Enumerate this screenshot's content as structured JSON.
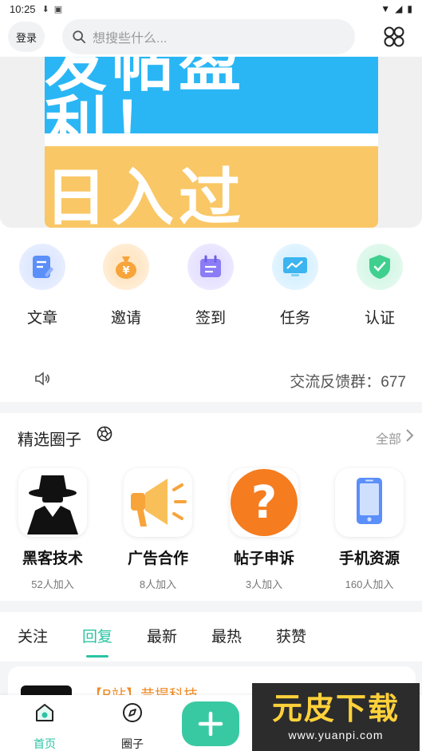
{
  "status_bar": {
    "time": "10:25"
  },
  "header": {
    "login_label": "登录",
    "search_placeholder": "想搜些什么..."
  },
  "banner": {
    "line1": "发帖盈利！",
    "line2": "日入过百！"
  },
  "shortcuts": [
    {
      "label": "文章",
      "icon": "article-icon",
      "color": "#5b8ff9"
    },
    {
      "label": "邀请",
      "icon": "money-bag-icon",
      "color": "#f7a43b"
    },
    {
      "label": "签到",
      "icon": "calendar-icon",
      "color": "#8b7cf6"
    },
    {
      "label": "任务",
      "icon": "monitor-chart-icon",
      "color": "#3bb4ef"
    },
    {
      "label": "认证",
      "icon": "shield-check-icon",
      "color": "#3fcf8e"
    }
  ],
  "notice": {
    "text": "交流反馈群：677"
  },
  "circles": {
    "title": "精选圈子",
    "all_label": "全部",
    "items": [
      {
        "name": "黑客技术",
        "count": "52人加入"
      },
      {
        "name": "广告合作",
        "count": "8人加入"
      },
      {
        "name": "帖子申诉",
        "count": "3人加入"
      },
      {
        "name": "手机资源",
        "count": "160人加入"
      }
    ]
  },
  "tabs": [
    {
      "label": "关注"
    },
    {
      "label": "回复",
      "active": true
    },
    {
      "label": "最新"
    },
    {
      "label": "最热"
    },
    {
      "label": "获赞"
    }
  ],
  "post_preview": {
    "title": "【B站】昔提科技"
  },
  "bottom_nav": [
    {
      "label": "首页",
      "active": true
    },
    {
      "label": "圈子"
    }
  ],
  "watermark": {
    "line1": "元皮下载",
    "line2": "www.yuanpi.com"
  },
  "colors": {
    "accent": "#2bc3a3",
    "fab": "#39c9a2"
  }
}
